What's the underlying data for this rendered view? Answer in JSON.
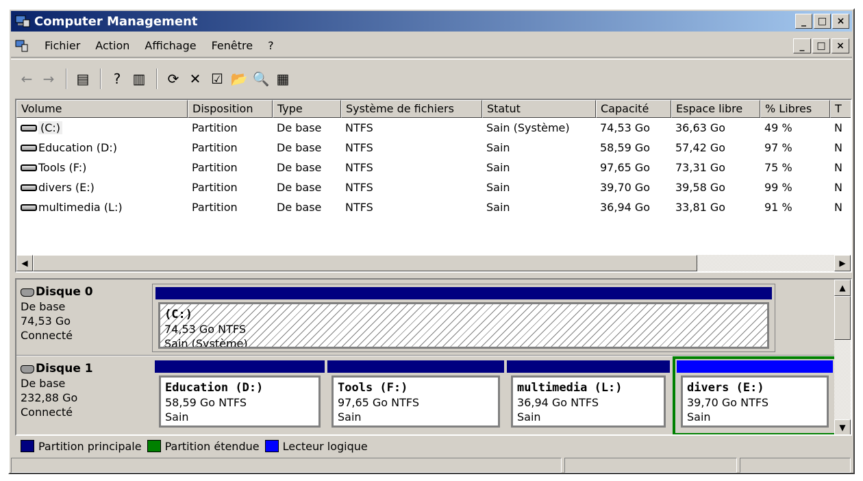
{
  "window": {
    "title": "Computer Management",
    "minimize_glyph": "_",
    "maximize_glyph": "□",
    "close_glyph": "×"
  },
  "menu": {
    "items": [
      "Fichier",
      "Action",
      "Affichage",
      "Fenêtre",
      "?"
    ]
  },
  "toolbar": {
    "buttons": [
      {
        "icon": "back-arrow-icon",
        "glyph": "←"
      },
      {
        "icon": "forward-arrow-icon",
        "glyph": "→"
      },
      {
        "icon": "show-hide-tree-icon",
        "glyph": "▤"
      },
      {
        "icon": "help-icon",
        "glyph": "?"
      },
      {
        "icon": "show-hide-action-pane-icon",
        "glyph": "▥"
      },
      {
        "icon": "refresh-icon",
        "glyph": "⟳"
      },
      {
        "icon": "delete-icon",
        "glyph": "✕"
      },
      {
        "icon": "properties-icon",
        "glyph": "☑"
      },
      {
        "icon": "open-folder-icon",
        "glyph": "📂"
      },
      {
        "icon": "search-icon",
        "glyph": "🔍"
      },
      {
        "icon": "disk-tool-icon",
        "glyph": "▦"
      }
    ]
  },
  "volume_list": {
    "columns": [
      "Volume",
      "Disposition",
      "Type",
      "Système de fichiers",
      "Statut",
      "Capacité",
      "Espace libre",
      "% Libres",
      "T"
    ],
    "rows": [
      {
        "volume": "(C:)",
        "disposition": "Partition",
        "type": "De base",
        "fs": "NTFS",
        "status": "Sain (Système)",
        "capacity": "74,53 Go",
        "free": "36,63 Go",
        "pct": "49 %",
        "t": "N"
      },
      {
        "volume": "Education (D:)",
        "disposition": "Partition",
        "type": "De base",
        "fs": "NTFS",
        "status": "Sain",
        "capacity": "58,59 Go",
        "free": "57,42 Go",
        "pct": "97 %",
        "t": "N"
      },
      {
        "volume": "Tools (F:)",
        "disposition": "Partition",
        "type": "De base",
        "fs": "NTFS",
        "status": "Sain",
        "capacity": "97,65 Go",
        "free": "73,31 Go",
        "pct": "75 %",
        "t": "N"
      },
      {
        "volume": "divers (E:)",
        "disposition": "Partition",
        "type": "De base",
        "fs": "NTFS",
        "status": "Sain",
        "capacity": "39,70 Go",
        "free": "39,58 Go",
        "pct": "99 %",
        "t": "N"
      },
      {
        "volume": "multimedia (L:)",
        "disposition": "Partition",
        "type": "De base",
        "fs": "NTFS",
        "status": "Sain",
        "capacity": "36,94 Go",
        "free": "33,81 Go",
        "pct": "91 %",
        "t": "N"
      }
    ]
  },
  "disks": [
    {
      "name": "Disque 0",
      "type": "De base",
      "size": "74,53 Go",
      "state": "Connecté",
      "partitions": [
        {
          "name": "(C:)",
          "size_fs": "74,53 Go NTFS",
          "status": "Sain (Système)"
        }
      ]
    },
    {
      "name": "Disque 1",
      "type": "De base",
      "size": "232,88 Go",
      "state": "Connecté",
      "partitions": [
        {
          "name": "Education (D:)",
          "size_fs": "58,59 Go NTFS",
          "status": "Sain"
        },
        {
          "name": "Tools (F:)",
          "size_fs": "97,65 Go NTFS",
          "status": "Sain"
        },
        {
          "name": "multimedia (L:)",
          "size_fs": "36,94 Go NTFS",
          "status": "Sain"
        },
        {
          "name": "divers (E:)",
          "size_fs": "39,70 Go NTFS",
          "status": "Sain"
        }
      ]
    }
  ],
  "legend": {
    "items": [
      {
        "label": "Partition principale",
        "color": "#000080"
      },
      {
        "label": "Partition étendue",
        "color": "#008000"
      },
      {
        "label": "Lecteur logique",
        "color": "#0000ff"
      }
    ]
  },
  "colors": {
    "title_bar": "#0a246a",
    "primary_partition": "#000080",
    "extended_partition": "#008000",
    "logical_drive": "#0000ff",
    "window_face": "#d4d0c8"
  }
}
